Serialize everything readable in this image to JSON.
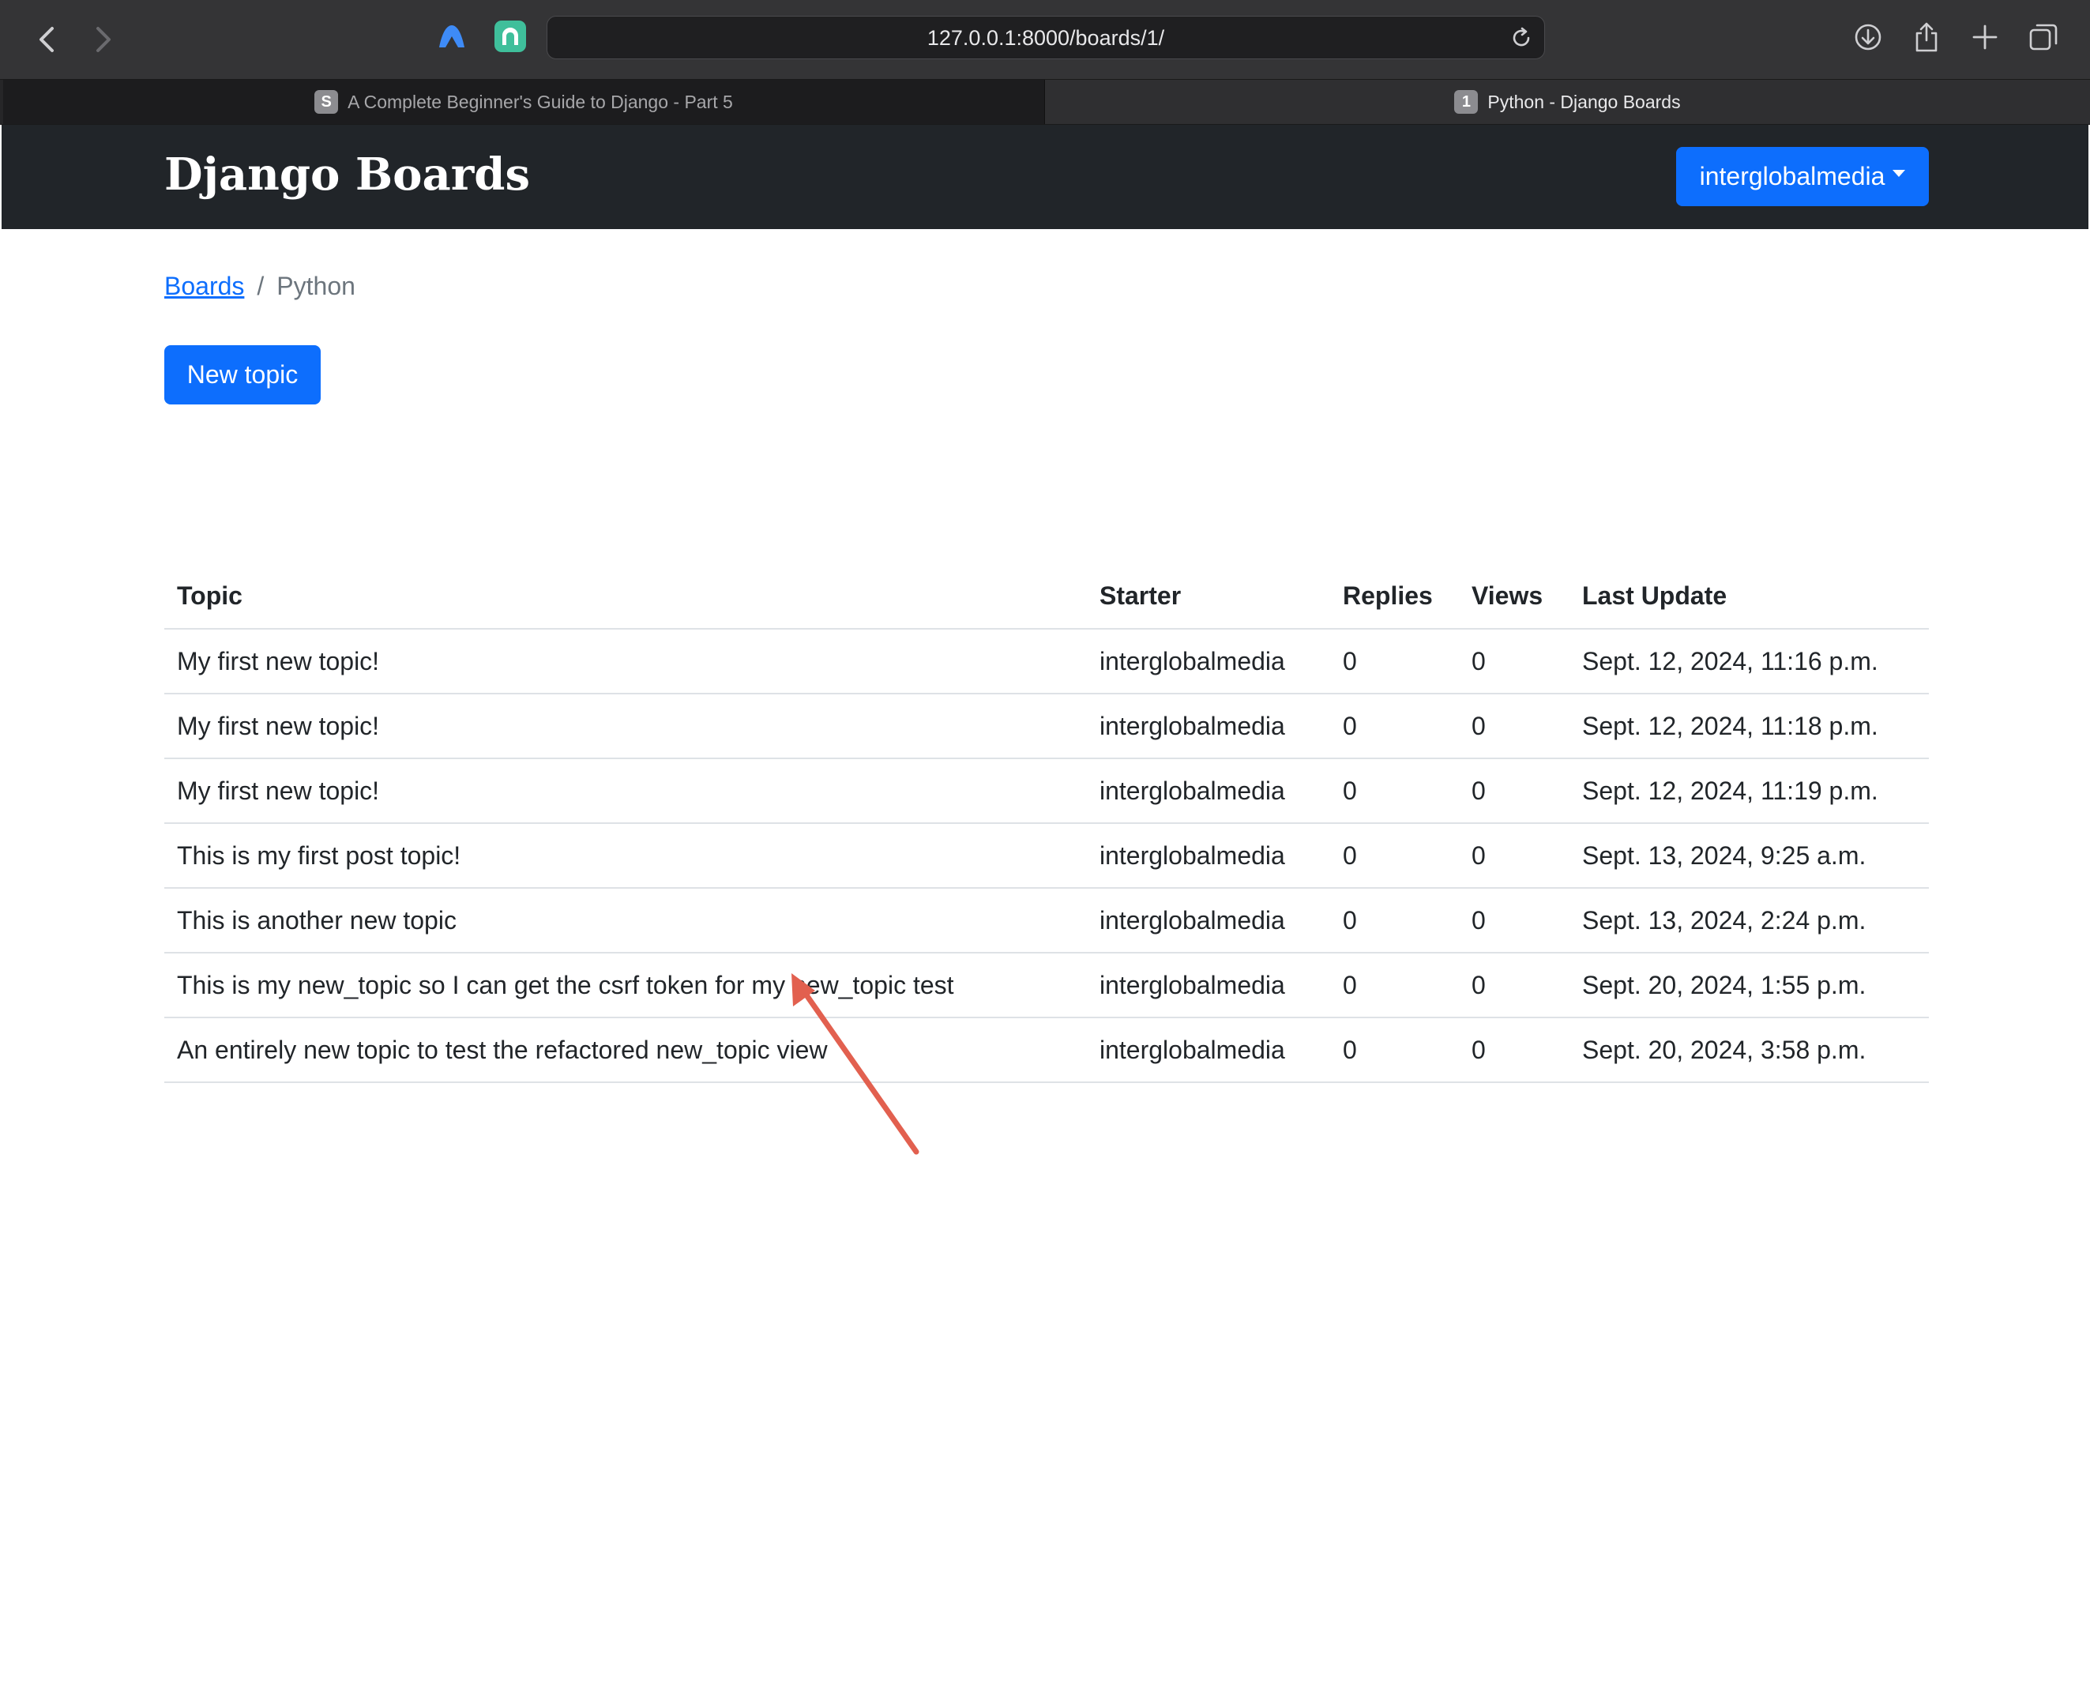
{
  "browser": {
    "url": "127.0.0.1:8000/boards/1/",
    "tabs": [
      {
        "favicon": "S",
        "label": "A Complete Beginner's Guide to Django - Part 5",
        "active": false
      },
      {
        "favicon": "1",
        "label": "Python - Django Boards",
        "active": true
      }
    ],
    "icons": [
      "back-icon",
      "forward-icon",
      "vpn-extension-icon",
      "extension-icon",
      "reload-icon",
      "download-icon",
      "share-icon",
      "new-tab-icon",
      "tab-overview-icon"
    ]
  },
  "navbar": {
    "brand": "Django Boards",
    "user": "interglobalmedia"
  },
  "breadcrumb": {
    "link": "Boards",
    "separator": "/",
    "current": "Python"
  },
  "actions": {
    "new_topic": "New topic"
  },
  "table": {
    "headers": [
      "Topic",
      "Starter",
      "Replies",
      "Views",
      "Last Update"
    ],
    "rows": [
      [
        "My first new topic!",
        "interglobalmedia",
        "0",
        "0",
        "Sept. 12, 2024, 11:16 p.m."
      ],
      [
        "My first new topic!",
        "interglobalmedia",
        "0",
        "0",
        "Sept. 12, 2024, 11:18 p.m."
      ],
      [
        "My first new topic!",
        "interglobalmedia",
        "0",
        "0",
        "Sept. 12, 2024, 11:19 p.m."
      ],
      [
        "This is my first post topic!",
        "interglobalmedia",
        "0",
        "0",
        "Sept. 13, 2024, 9:25 a.m."
      ],
      [
        "This is another new topic",
        "interglobalmedia",
        "0",
        "0",
        "Sept. 13, 2024, 2:24 p.m."
      ],
      [
        "This is my new_topic so I can get the csrf token for my new_topic test",
        "interglobalmedia",
        "0",
        "0",
        "Sept. 20, 2024, 1:55 p.m."
      ],
      [
        "An entirely new topic to test the refactored new_topic view",
        "interglobalmedia",
        "0",
        "0",
        "Sept. 20, 2024, 3:58 p.m."
      ]
    ]
  },
  "colors": {
    "primary": "#0d6efd",
    "navbar": "#212529",
    "annotation_arrow": "#e2604f"
  }
}
